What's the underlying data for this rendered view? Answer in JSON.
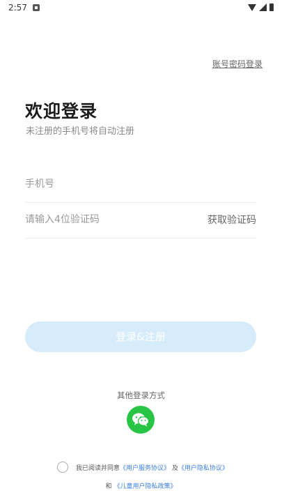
{
  "status_bar": {
    "time": "2:57"
  },
  "header": {
    "account_login_link": "账号密码登录"
  },
  "main": {
    "title": "欢迎登录",
    "subtitle": "未注册的手机号将自动注册",
    "phone_placeholder": "手机号",
    "code_placeholder": "请输入4位验证码",
    "get_code_label": "获取验证码",
    "login_button_label": "登录&注册"
  },
  "other_login": {
    "label": "其他登录方式",
    "wechat_icon": "wechat-icon"
  },
  "agreement": {
    "prefix": "我已阅读并同意",
    "service_link": "《用户服务协议》",
    "and1": "及",
    "privacy_link": "《用户隐私协议》",
    "and2": "和",
    "child_privacy_link": "《儿童用户隐私政策》"
  },
  "colors": {
    "accent": "#3a7fe0",
    "button_disabled": "#d6ecfb",
    "wechat": "#28c445"
  }
}
